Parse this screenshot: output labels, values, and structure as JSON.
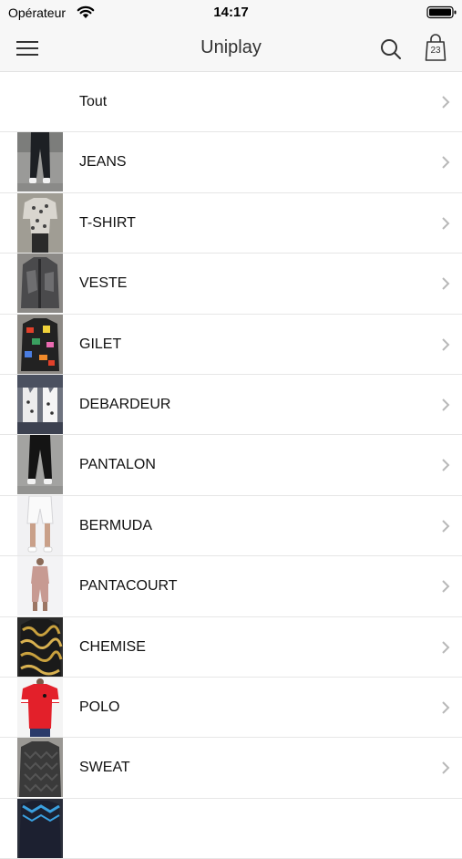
{
  "status_bar": {
    "carrier": "Opérateur",
    "time": "14:17"
  },
  "nav": {
    "title": "Uniplay",
    "cart_count": "23"
  },
  "categories": [
    {
      "label": "Tout",
      "thumb": "none"
    },
    {
      "label": "JEANS",
      "thumb": "jeans-photo"
    },
    {
      "label": "T-SHIRT",
      "thumb": "tshirt-photo"
    },
    {
      "label": "VESTE",
      "thumb": "veste-photo"
    },
    {
      "label": "GILET",
      "thumb": "gilet-photo"
    },
    {
      "label": "DEBARDEUR",
      "thumb": "debardeur-photo"
    },
    {
      "label": "PANTALON",
      "thumb": "pantalon-photo"
    },
    {
      "label": "BERMUDA",
      "thumb": "bermuda-photo"
    },
    {
      "label": "PANTACOURT",
      "thumb": "pantacourt-photo"
    },
    {
      "label": "CHEMISE",
      "thumb": "chemise-photo"
    },
    {
      "label": "POLO",
      "thumb": "polo-photo"
    },
    {
      "label": "SWEAT",
      "thumb": "sweat-photo"
    },
    {
      "label": "",
      "thumb": "partial-photo"
    }
  ],
  "colors": {
    "bar_background": "#f7f7f7",
    "separator": "#e6e6e6",
    "chevron": "#b8b8b8"
  }
}
